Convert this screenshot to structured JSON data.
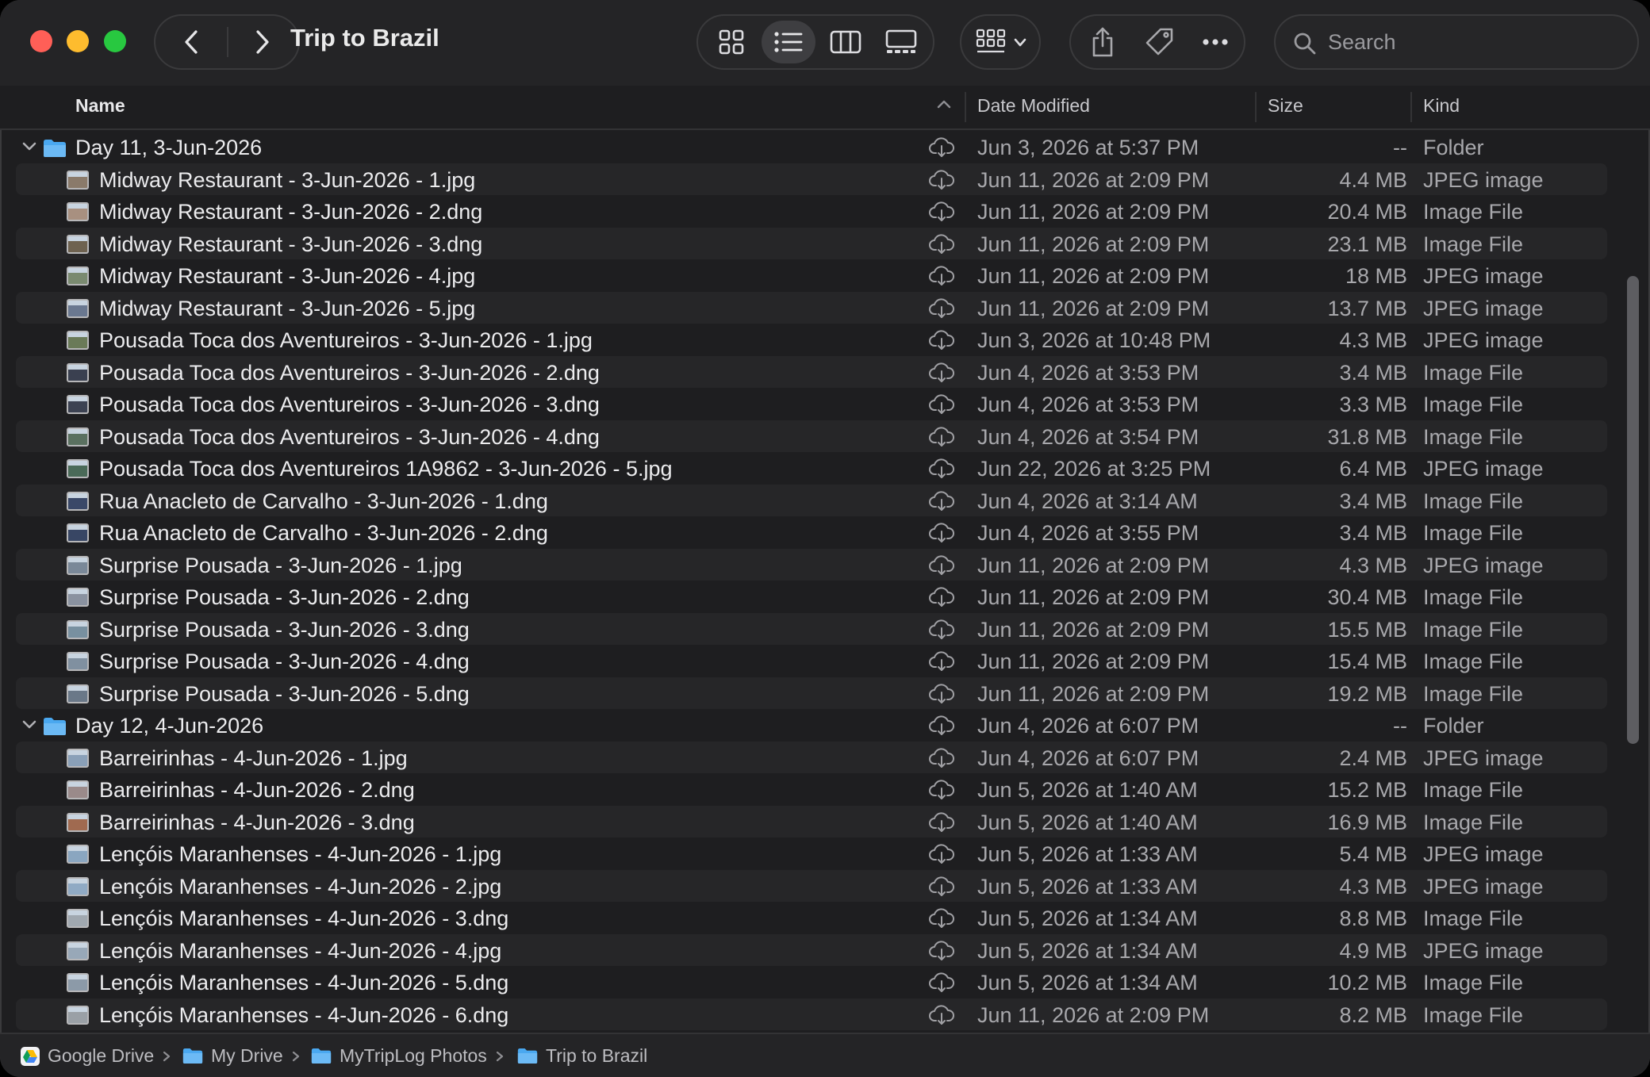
{
  "window": {
    "title": "Trip to Brazil"
  },
  "search": {
    "placeholder": "Search"
  },
  "columns": {
    "name": "Name",
    "date": "Date Modified",
    "size": "Size",
    "kind": "Kind"
  },
  "colors": {
    "folder": "#4aa8f0",
    "background": "#1e1e20",
    "alt_row": "#262628"
  },
  "rows": [
    {
      "type": "folder",
      "name": "Day 11, 3-Jun-2026",
      "date": "Jun 3, 2026 at 5:37 PM",
      "size": "--",
      "kind": "Folder"
    },
    {
      "type": "file",
      "name": "Midway Restaurant - 3-Jun-2026 - 1.jpg",
      "date": "Jun 11, 2026 at 2:09 PM",
      "size": "4.4 MB",
      "kind": "JPEG image",
      "thumb": "#8a7a6a"
    },
    {
      "type": "file",
      "name": "Midway Restaurant - 3-Jun-2026 - 2.dng",
      "date": "Jun 11, 2026 at 2:09 PM",
      "size": "20.4 MB",
      "kind": "Image File",
      "thumb": "#a89080"
    },
    {
      "type": "file",
      "name": "Midway Restaurant - 3-Jun-2026 - 3.dng",
      "date": "Jun 11, 2026 at 2:09 PM",
      "size": "23.1 MB",
      "kind": "Image File",
      "thumb": "#6e6250"
    },
    {
      "type": "file",
      "name": "Midway Restaurant - 3-Jun-2026 - 4.jpg",
      "date": "Jun 11, 2026 at 2:09 PM",
      "size": "18 MB",
      "kind": "JPEG image",
      "thumb": "#7a8a70"
    },
    {
      "type": "file",
      "name": "Midway Restaurant - 3-Jun-2026 - 5.jpg",
      "date": "Jun 11, 2026 at 2:09 PM",
      "size": "13.7 MB",
      "kind": "JPEG image",
      "thumb": "#6a7890"
    },
    {
      "type": "file",
      "name": "Pousada Toca dos Aventureiros - 3-Jun-2026 - 1.jpg",
      "date": "Jun 3, 2026 at 10:48 PM",
      "size": "4.3 MB",
      "kind": "JPEG image",
      "thumb": "#6a7a58"
    },
    {
      "type": "file",
      "name": "Pousada Toca dos Aventureiros - 3-Jun-2026 - 2.dng",
      "date": "Jun 4, 2026 at 3:53 PM",
      "size": "3.4 MB",
      "kind": "Image File",
      "thumb": "#3a4050"
    },
    {
      "type": "file",
      "name": "Pousada Toca dos Aventureiros - 3-Jun-2026 - 3.dng",
      "date": "Jun 4, 2026 at 3:53 PM",
      "size": "3.3 MB",
      "kind": "Image File",
      "thumb": "#3c4252"
    },
    {
      "type": "file",
      "name": "Pousada Toca dos Aventureiros - 3-Jun-2026 - 4.dng",
      "date": "Jun 4, 2026 at 3:54 PM",
      "size": "31.8 MB",
      "kind": "Image File",
      "thumb": "#5a7060"
    },
    {
      "type": "file",
      "name": "Pousada Toca dos Aventureiros 1A9862 - 3-Jun-2026 - 5.jpg",
      "date": "Jun 22, 2026 at 3:25 PM",
      "size": "6.4 MB",
      "kind": "JPEG image",
      "thumb": "#4a6a58"
    },
    {
      "type": "file",
      "name": "Rua Anacleto de Carvalho - 3-Jun-2026 - 1.dng",
      "date": "Jun 4, 2026 at 3:14 AM",
      "size": "3.4 MB",
      "kind": "Image File",
      "thumb": "#3a4868"
    },
    {
      "type": "file",
      "name": "Rua Anacleto de Carvalho - 3-Jun-2026 - 2.dng",
      "date": "Jun 4, 2026 at 3:55 PM",
      "size": "3.4 MB",
      "kind": "Image File",
      "thumb": "#384664"
    },
    {
      "type": "file",
      "name": "Surprise Pousada - 3-Jun-2026 - 1.jpg",
      "date": "Jun 11, 2026 at 2:09 PM",
      "size": "4.3 MB",
      "kind": "JPEG image",
      "thumb": "#7a8898"
    },
    {
      "type": "file",
      "name": "Surprise Pousada - 3-Jun-2026 - 2.dng",
      "date": "Jun 11, 2026 at 2:09 PM",
      "size": "30.4 MB",
      "kind": "Image File",
      "thumb": "#8a92a0"
    },
    {
      "type": "file",
      "name": "Surprise Pousada - 3-Jun-2026 - 3.dng",
      "date": "Jun 11, 2026 at 2:09 PM",
      "size": "15.5 MB",
      "kind": "Image File",
      "thumb": "#7890a0"
    },
    {
      "type": "file",
      "name": "Surprise Pousada - 3-Jun-2026 - 4.dng",
      "date": "Jun 11, 2026 at 2:09 PM",
      "size": "15.4 MB",
      "kind": "Image File",
      "thumb": "#8090a0"
    },
    {
      "type": "file",
      "name": "Surprise Pousada - 3-Jun-2026 - 5.dng",
      "date": "Jun 11, 2026 at 2:09 PM",
      "size": "19.2 MB",
      "kind": "Image File",
      "thumb": "#6a7888"
    },
    {
      "type": "folder",
      "name": "Day 12, 4-Jun-2026",
      "date": "Jun 4, 2026 at 6:07 PM",
      "size": "--",
      "kind": "Folder"
    },
    {
      "type": "file",
      "name": "Barreirinhas - 4-Jun-2026 - 1.jpg",
      "date": "Jun 4, 2026 at 6:07 PM",
      "size": "2.4 MB",
      "kind": "JPEG image",
      "thumb": "#8aa0b8"
    },
    {
      "type": "file",
      "name": "Barreirinhas - 4-Jun-2026 - 2.dng",
      "date": "Jun 5, 2026 at 1:40 AM",
      "size": "15.2 MB",
      "kind": "Image File",
      "thumb": "#9a8a8a"
    },
    {
      "type": "file",
      "name": "Barreirinhas - 4-Jun-2026 - 3.dng",
      "date": "Jun 5, 2026 at 1:40 AM",
      "size": "16.9 MB",
      "kind": "Image File",
      "thumb": "#a06a50"
    },
    {
      "type": "file",
      "name": "Lençóis Maranhenses - 4-Jun-2026 - 1.jpg",
      "date": "Jun 5, 2026 at 1:33 AM",
      "size": "5.4 MB",
      "kind": "JPEG image",
      "thumb": "#8aa6c0"
    },
    {
      "type": "file",
      "name": "Lençóis Maranhenses - 4-Jun-2026 - 2.jpg",
      "date": "Jun 5, 2026 at 1:33 AM",
      "size": "4.3 MB",
      "kind": "JPEG image",
      "thumb": "#90aac4"
    },
    {
      "type": "file",
      "name": "Lençóis Maranhenses - 4-Jun-2026 - 3.dng",
      "date": "Jun 5, 2026 at 1:34 AM",
      "size": "8.8 MB",
      "kind": "Image File",
      "thumb": "#a0a8b0"
    },
    {
      "type": "file",
      "name": "Lençóis Maranhenses - 4-Jun-2026 - 4.jpg",
      "date": "Jun 5, 2026 at 1:34 AM",
      "size": "4.9 MB",
      "kind": "JPEG image",
      "thumb": "#98a8b8"
    },
    {
      "type": "file",
      "name": "Lençóis Maranhenses - 4-Jun-2026 - 5.dng",
      "date": "Jun 5, 2026 at 1:34 AM",
      "size": "10.2 MB",
      "kind": "Image File",
      "thumb": "#8c9aa8"
    },
    {
      "type": "file",
      "name": "Lençóis Maranhenses - 4-Jun-2026 - 6.dng",
      "date": "Jun 11, 2026 at 2:09 PM",
      "size": "8.2 MB",
      "kind": "Image File",
      "thumb": "#9aa0a6"
    }
  ],
  "pathbar": [
    {
      "label": "Google Drive",
      "icon": "google-drive-icon"
    },
    {
      "label": "My Drive",
      "icon": "folder-icon"
    },
    {
      "label": "MyTripLog Photos",
      "icon": "folder-icon"
    },
    {
      "label": "Trip to Brazil",
      "icon": "folder-icon"
    }
  ]
}
